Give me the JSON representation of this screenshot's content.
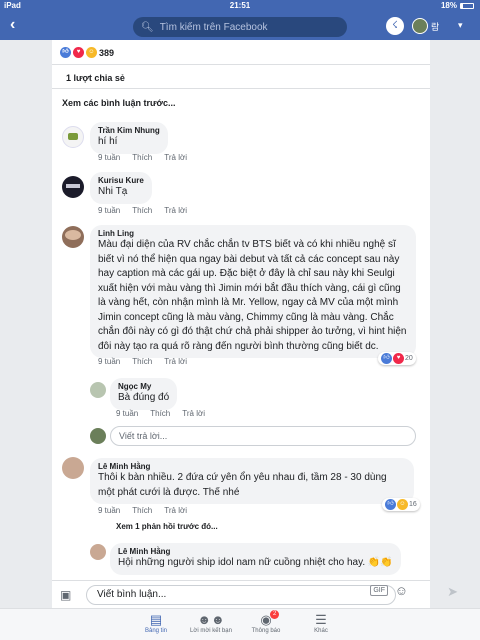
{
  "status_bar": {
    "device": "iPad",
    "time": "21:51",
    "battery": "18%"
  },
  "navbar": {
    "back_icon": "chevron-left-icon",
    "search_placeholder": "Tìm kiếm trên Facebook",
    "user_name": "람"
  },
  "post": {
    "reaction_count": "389",
    "share_count": "1 lượt chia sẻ",
    "prev_comments_label": "Xem các bình luận trước..."
  },
  "comment_actions": {
    "like": "Thích",
    "reply": "Trả lời"
  },
  "comments": [
    {
      "name": "Trần Kim Nhung",
      "text": "hí hí",
      "time": "9 tuần"
    },
    {
      "name": "Kurisu Kure",
      "text": "Nhi Tạ",
      "time": "9 tuần"
    },
    {
      "name": "Linh Ling",
      "text": "Màu đại diện của RV chắc chắn tv BTS biết và có khi nhiều nghệ sĩ biết vì nó thể hiện qua ngay bài debut và tất cả các concept sau này hay caption mà các gái up. Đặc biệt ở đây là chỉ sau này khi Seulgi xuất hiện với màu vàng thì Jimin mới bắt đầu thích vàng, cái gì cũng là vàng hết, còn nhận mình là Mr. Yellow, ngay cả MV của một mình Jimin concept cũng là màu vàng, Chimmy cũng là màu vàng. Chắc chắn đôi này có gì đó thật chứ chả phải shipper ảo tưởng, vì hint hiện đôi này tạo ra quá rõ ràng đến người bình thường cũng biết dc.",
      "time": "9 tuần",
      "reaction_count": "20"
    },
    {
      "name": "Ngọc My",
      "text": "Bà đúng đó",
      "time": "9 tuần"
    },
    {
      "name": "Lê Minh Hằng",
      "text": "Thôi k bàn nhiều. 2 đứa cứ yên ổn yêu nhau đi, tầm 28 - 30 dùng một phát cưới là được. Thế nhé",
      "time": "9 tuần",
      "reaction_count": "16"
    },
    {
      "name": "Lê Minh Hằng",
      "text": "Hội những người ship idol nam nữ cuồng nhiệt cho hay. 👏👏",
      "time": ""
    }
  ],
  "reply_placeholder": "Viết trả lời...",
  "view_prev_replies": "Xem 1 phản hồi trước đó...",
  "composer": {
    "placeholder": "Viết bình luận...",
    "gif_label": "GIF"
  },
  "tabs": [
    {
      "label": "Bảng tin",
      "icon": "news-feed-icon"
    },
    {
      "label": "Lời mời kết bạn",
      "icon": "friends-icon"
    },
    {
      "label": "Thông báo",
      "icon": "bell-icon",
      "badge": "2"
    },
    {
      "label": "Khác",
      "icon": "menu-icon"
    }
  ],
  "colors": {
    "brand": "#4267b2",
    "like": "#4a7bd8",
    "love": "#f0284a",
    "haha": "#f7b928",
    "badge": "#fa3e3e"
  }
}
